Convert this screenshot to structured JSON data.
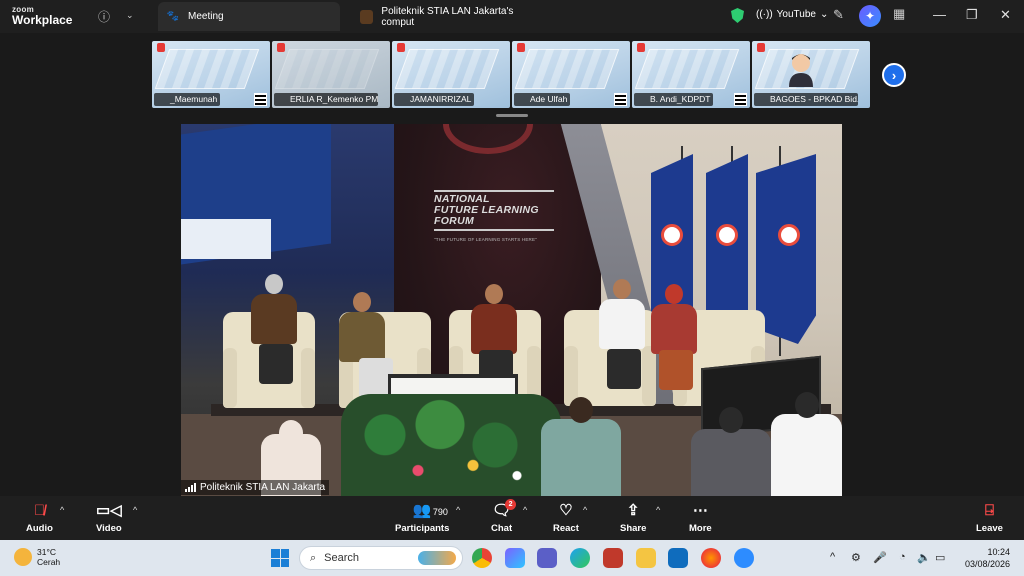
{
  "app": {
    "logo_top": "zoom",
    "logo_bottom": "Workplace"
  },
  "tabs": [
    {
      "label": "Meeting",
      "active": true
    },
    {
      "label": "Politeknik STIA LAN Jakarta's comput",
      "active": false
    }
  ],
  "header": {
    "youtube_label": "YouTube"
  },
  "gallery": {
    "participants": [
      {
        "name": "_Maemunah"
      },
      {
        "name": "ERLIA R_Kemenko PMK"
      },
      {
        "name": "JAMANIRRIZAL"
      },
      {
        "name": "Ade Ulfah"
      },
      {
        "name": "B. Andi_KDPDT"
      },
      {
        "name": "BAGOES - BPKAD Bid..."
      }
    ]
  },
  "video": {
    "speaker_name": "Politeknik STIA LAN Jakarta",
    "screen_title_1": "NATIONAL",
    "screen_title_2": "FUTURE LEARNING",
    "screen_title_3": "FORUM",
    "screen_subtitle": "\"THE FUTURE OF LEARNING STARTS HERE\"",
    "flag_text": "POLITEKNIK STIA LAN"
  },
  "toolbar": {
    "audio": "Audio",
    "video": "Video",
    "participants": "Participants",
    "participant_count": "790",
    "chat": "Chat",
    "chat_badge": "2",
    "react": "React",
    "share": "Share",
    "more": "More",
    "leave": "Leave"
  },
  "taskbar": {
    "temperature": "31°C",
    "weather": "Cerah",
    "search_placeholder": "Search",
    "time": "10:24",
    "date": "03/08/2026"
  },
  "colors": {
    "accent": "#1f6feb",
    "danger": "#e53935",
    "toolbar_bg": "#1f1f1f"
  }
}
